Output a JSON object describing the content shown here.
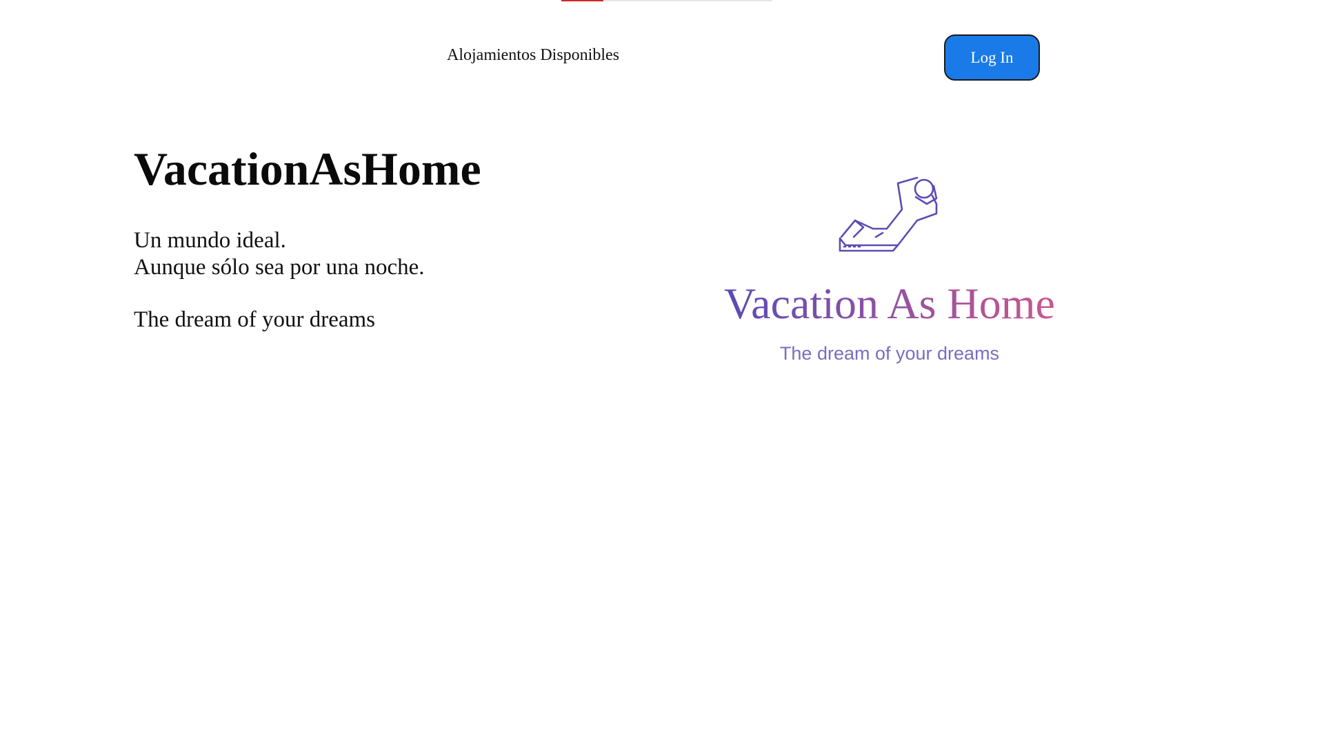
{
  "header": {
    "loading_progress": 0.2,
    "nav_link_label": "Alojamientos Disponibles",
    "login_label": "Log In"
  },
  "hero": {
    "title": "VacationAsHome",
    "line1": "Un mundo ideal.",
    "line2": "Aunque sólo sea por una noche.",
    "tagline": "The dream of your dreams"
  },
  "logo": {
    "wordmark": "Vacation As Home",
    "slogan": "The dream of your dreams",
    "icon": "relaxing-person-icon"
  },
  "colors": {
    "accent": "#1a7ae8",
    "progress": "#cc2a2a",
    "logo_purple": "#5a4bb5",
    "logo_pink": "#c9578f"
  }
}
